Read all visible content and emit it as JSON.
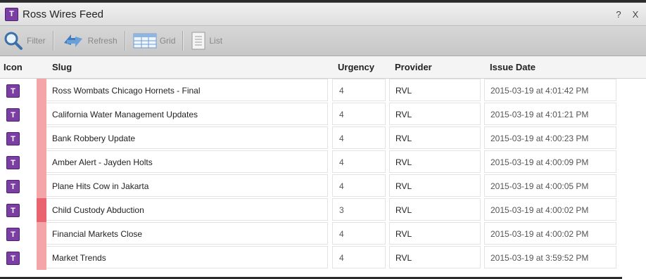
{
  "window": {
    "title": "Ross Wires Feed",
    "help_label": "?",
    "close_label": "X"
  },
  "toolbar": {
    "filter_label": "Filter",
    "refresh_label": "Refresh",
    "grid_label": "Grid",
    "list_label": "List"
  },
  "columns": {
    "icon": "Icon",
    "slug": "Slug",
    "urgency": "Urgency",
    "provider": "Provider",
    "issue_date": "Issue Date"
  },
  "rows": [
    {
      "slug": "Ross Wombats Chicago Hornets - Final",
      "urgency": "4",
      "provider": "RVL",
      "issue_date": "2015-03-19 at 4:01:42 PM"
    },
    {
      "slug": "California Water Management Updates",
      "urgency": "4",
      "provider": "RVL",
      "issue_date": "2015-03-19 at 4:01:21 PM"
    },
    {
      "slug": "Bank Robbery Update",
      "urgency": "4",
      "provider": "RVL",
      "issue_date": "2015-03-19 at 4:00:23 PM"
    },
    {
      "slug": "Amber Alert - Jayden Holts",
      "urgency": "4",
      "provider": "RVL",
      "issue_date": "2015-03-19 at 4:00:09 PM"
    },
    {
      "slug": "Plane Hits Cow in Jakarta",
      "urgency": "4",
      "provider": "RVL",
      "issue_date": "2015-03-19 at 4:00:05 PM"
    },
    {
      "slug": "Child Custody Abduction",
      "urgency": "3",
      "provider": "RVL",
      "issue_date": "2015-03-19 at 4:00:02 PM"
    },
    {
      "slug": "Financial Markets Close",
      "urgency": "4",
      "provider": "RVL",
      "issue_date": "2015-03-19 at 4:00:02 PM"
    },
    {
      "slug": "Market Trends",
      "urgency": "4",
      "provider": "RVL",
      "issue_date": "2015-03-19 at 3:59:52 PM"
    }
  ],
  "colors": {
    "icon_purple": "#7b3fa3",
    "urgency_4": "#f3a5a8",
    "urgency_3": "#ea6470"
  },
  "icons": {
    "app": "wire-feed-icon",
    "filter": "magnifier-icon",
    "refresh": "refresh-arrows-icon",
    "grid": "grid-view-icon",
    "list": "list-view-icon"
  }
}
